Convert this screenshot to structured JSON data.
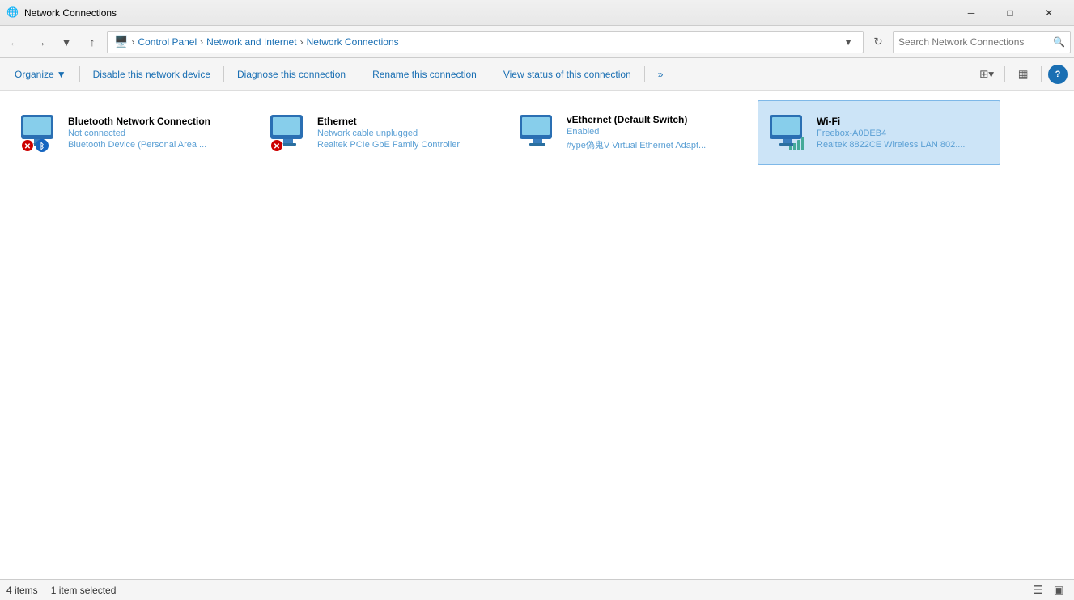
{
  "window": {
    "title": "Network Connections",
    "icon": "🌐"
  },
  "titlebar": {
    "minimize": "─",
    "maximize": "□",
    "close": "✕"
  },
  "addressbar": {
    "back_disabled": true,
    "forward_disabled": false,
    "up_disabled": false,
    "breadcrumb": [
      "Control Panel",
      "Network and Internet",
      "Network Connections"
    ],
    "search_placeholder": "Search Network Connections",
    "search_icon": "🔍"
  },
  "toolbar": {
    "organize": "Organize",
    "disable_network_device": "Disable this network device",
    "diagnose_connection": "Diagnose this connection",
    "rename_connection": "Rename this connection",
    "view_status": "View status of this connection",
    "more": "»",
    "view_options_icon": "⊞",
    "help_label": "?"
  },
  "connections": [
    {
      "id": "bluetooth",
      "name": "Bluetooth Network Connection",
      "status": "Not connected",
      "adapter": "Bluetooth Device (Personal Area ...",
      "selected": false,
      "overlay_type": "bluetooth_error",
      "icon_color": "#2a6fb3"
    },
    {
      "id": "ethernet",
      "name": "Ethernet",
      "status": "Network cable unplugged",
      "adapter": "Realtek PCIe GbE Family Controller",
      "selected": false,
      "overlay_type": "error",
      "icon_color": "#2a6fb3"
    },
    {
      "id": "vethernet",
      "name": "vEthernet (Default Switch)",
      "status": "Enabled",
      "adapter": "#ype偽鬼V Virtual Ethernet Adapt...",
      "selected": false,
      "overlay_type": "none",
      "icon_color": "#2a6fb3"
    },
    {
      "id": "wifi",
      "name": "Wi-Fi",
      "status": "Freebox-A0DEB4",
      "adapter": "Realtek 8822CE Wireless LAN 802....",
      "selected": true,
      "overlay_type": "signal",
      "icon_color": "#2a6fb3"
    }
  ],
  "statusbar": {
    "item_count": "4 items",
    "selected_text": "1 item selected",
    "items_label": "Items"
  }
}
